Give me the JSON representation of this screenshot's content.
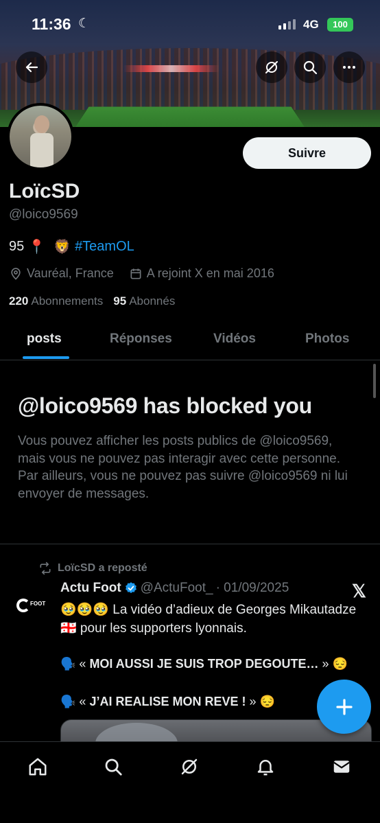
{
  "status_bar": {
    "time": "11:36",
    "network": "4G",
    "battery": "100"
  },
  "profile": {
    "display_name": "LoïcSD",
    "handle": "@loico9569",
    "bio_count": "95",
    "bio_pin_emoji": "📍",
    "bio_lion_emoji": "🦁",
    "bio_hashtag": "#TeamOL",
    "location": "Vauréal, France",
    "joined": "A rejoint X en mai 2016",
    "following_count": "220",
    "following_label": "Abonnements",
    "followers_count": "95",
    "followers_label": "Abonnés",
    "follow_button": "Suivre"
  },
  "tabs": [
    {
      "label": "posts",
      "active": true
    },
    {
      "label": "Réponses",
      "active": false
    },
    {
      "label": "Vidéos",
      "active": false
    },
    {
      "label": "Photos",
      "active": false
    }
  ],
  "blocked": {
    "title": "@loico9569 has blocked you",
    "body": "Vous pouvez afficher les posts publics de @loico9569, mais vous ne pouvez pas interagir avec cette personne. Par ailleurs, vous ne pouvez pas suivre @loico9569 ni lui envoyer de messages."
  },
  "post": {
    "repost_label": "LoïcSD a reposté",
    "author_name": "Actu Foot",
    "author_handle": "@ActuFoot_",
    "date": "· 01/09/2025",
    "avatar_text": "FOOT",
    "text": "🥹🥹🥹 La vidéo d’adieux de Georges Mikautadze 🇬🇪 pour les supporters lyonnais.",
    "quote1_prefix": "🗣️ « ",
    "quote1_bold": "MOI AUSSI JE SUIS TROP DEGOUTE…",
    "quote1_suffix": " » 😔",
    "quote2_prefix": "🗣️ « ",
    "quote2_bold": "J’AI REALISE MON REVE !",
    "quote2_suffix": " » 😔",
    "x_logo": "𝕏"
  },
  "icons": {
    "back": "back-arrow-icon",
    "grok": "grok-icon",
    "search": "search-icon",
    "more": "more-icon",
    "location": "location-pin-icon",
    "calendar": "calendar-icon",
    "repost": "repost-icon",
    "verified": "verified-badge-icon",
    "compose": "plus-icon"
  },
  "colors": {
    "accent": "#1d9bf0",
    "secondary_text": "#71767b",
    "battery": "#34c759"
  }
}
